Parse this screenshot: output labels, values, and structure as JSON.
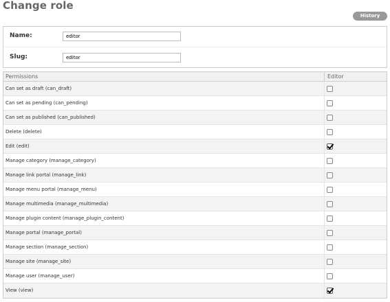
{
  "page": {
    "title": "Change role"
  },
  "history_label": "History",
  "form": {
    "name_label": "Name:",
    "name_value": "editor",
    "slug_label": "Slug:",
    "slug_value": "editor"
  },
  "table": {
    "col_permissions": "Permissions",
    "col_editor": "Editor",
    "rows": [
      {
        "label": "Can set as draft (can_draft)",
        "checked": false
      },
      {
        "label": "Can set as pending (can_pending)",
        "checked": false
      },
      {
        "label": "Can set as published (can_published)",
        "checked": false
      },
      {
        "label": "Delete (delete)",
        "checked": false
      },
      {
        "label": "Edit (edit)",
        "checked": true
      },
      {
        "label": "Manage category (manage_category)",
        "checked": false
      },
      {
        "label": "Manage link portal (manage_link)",
        "checked": false
      },
      {
        "label": "Manage menu portal (manage_menu)",
        "checked": false
      },
      {
        "label": "Manage multimedia (manage_multimedia)",
        "checked": false
      },
      {
        "label": "Manage plugin content (manage_plugin_content)",
        "checked": false
      },
      {
        "label": "Manage portal (manage_portal)",
        "checked": false
      },
      {
        "label": "Manage section (manage_section)",
        "checked": false
      },
      {
        "label": "Manage site (manage_site)",
        "checked": false
      },
      {
        "label": "Manage user (manage_user)",
        "checked": false
      },
      {
        "label": "View (view)",
        "checked": true
      }
    ]
  }
}
